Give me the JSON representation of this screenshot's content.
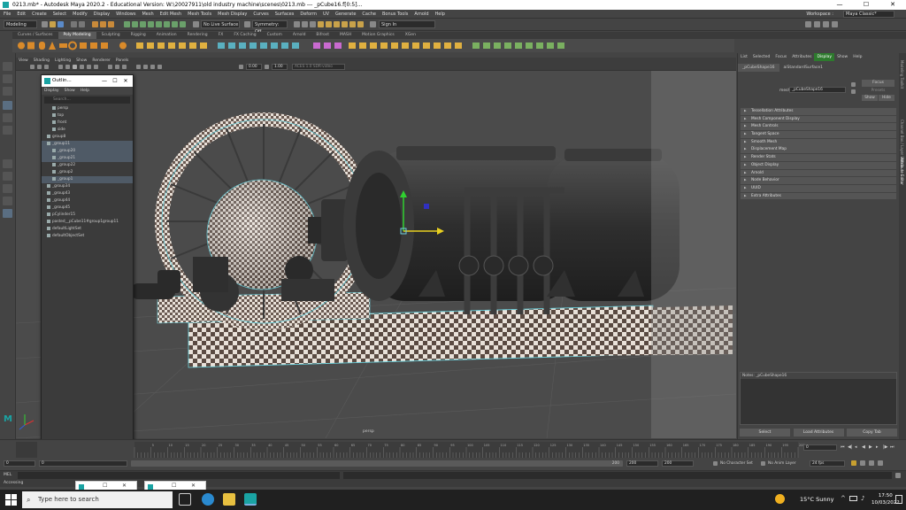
{
  "window": {
    "title": "0213.mb* - Autodesk Maya 2020.2 - Educational Version: W:\\20027911\\old industry machine\\scenes\\0213.mb  ---  _pCube16.f[0:5]...",
    "controls": [
      "—",
      "☐",
      "✕"
    ]
  },
  "menubar": {
    "items": [
      "File",
      "Edit",
      "Create",
      "Select",
      "Modify",
      "Display",
      "Windows",
      "Mesh",
      "Edit Mesh",
      "Mesh Tools",
      "Mesh Display",
      "Curves",
      "Surfaces",
      "Deform",
      "UV",
      "Generate",
      "Cache",
      "Bonus Tools",
      "Arnold",
      "Help"
    ],
    "workspace_label": "Workspace :",
    "workspace_value": "Maya Classic*"
  },
  "statusline": {
    "mode": "Modeling",
    "live_surface": "No Live Surface",
    "symmetry": "Symmetry: Off",
    "sign_in": "Sign In"
  },
  "shelf_tabs": {
    "items": [
      "Curves / Surfaces",
      "Poly Modeling",
      "Sculpting",
      "Rigging",
      "Animation",
      "Rendering",
      "FX",
      "FX Caching",
      "Custom",
      "Arnold",
      "Bifrost",
      "MASH",
      "Motion Graphics",
      "XGen"
    ],
    "active": "Poly Modeling"
  },
  "viewport": {
    "menu": [
      "View",
      "Shading",
      "Lighting",
      "Show",
      "Renderer",
      "Panels"
    ],
    "field_a": "0.00",
    "field_b": "1.00",
    "color_space": "ACES 1.0 SDR-video",
    "camera_label": "persp"
  },
  "outliner": {
    "title": "Outlin...",
    "controls": [
      "—",
      "☐",
      "✕"
    ],
    "menu": [
      "Display",
      "Show",
      "Help"
    ],
    "search_placeholder": "Search...",
    "items": [
      {
        "label": "persp",
        "selected": false,
        "indent": 1
      },
      {
        "label": "top",
        "selected": false,
        "indent": 1
      },
      {
        "label": "front",
        "selected": false,
        "indent": 1
      },
      {
        "label": "side",
        "selected": false,
        "indent": 1
      },
      {
        "label": "group8",
        "selected": false,
        "indent": 0
      },
      {
        "label": "_group11",
        "selected": true,
        "indent": 0
      },
      {
        "label": "_group20",
        "selected": true,
        "indent": 1
      },
      {
        "label": "_group21",
        "selected": true,
        "indent": 1
      },
      {
        "label": "_group22",
        "selected": false,
        "indent": 1
      },
      {
        "label": "_group2",
        "selected": false,
        "indent": 1
      },
      {
        "label": "_group1",
        "selected": true,
        "indent": 1
      },
      {
        "label": "_group34",
        "selected": false,
        "indent": 0
      },
      {
        "label": "_group43",
        "selected": false,
        "indent": 0
      },
      {
        "label": "_group44",
        "selected": false,
        "indent": 0
      },
      {
        "label": "_group45",
        "selected": false,
        "indent": 0
      },
      {
        "label": "pCylinder15",
        "selected": false,
        "indent": 0
      },
      {
        "label": "pasted__pCube11#group1group11",
        "selected": false,
        "indent": 0
      },
      {
        "label": "defaultLightSet",
        "selected": false,
        "indent": 0
      },
      {
        "label": "defaultObjectSet",
        "selected": false,
        "indent": 0
      }
    ]
  },
  "attribute_editor": {
    "menu": [
      "List",
      "Selected",
      "Focus",
      "Attributes",
      "Display",
      "Show",
      "Help"
    ],
    "tabs": [
      "_pCubeShape16",
      "aiStandardSurface1"
    ],
    "mesh_label": "mesh:",
    "mesh_value": "_pCubeShape16",
    "buttons_side": [
      "Focus",
      "Presets",
      "Show",
      "Hide"
    ],
    "sections": [
      "Tessellation Attributes",
      "Mesh Component Display",
      "Mesh Controls",
      "Tangent Space",
      "Smooth Mesh",
      "Displacement Map",
      "Render Stats",
      "Object Display",
      "Arnold",
      "Node Behavior",
      "UUID",
      "Extra Attributes"
    ],
    "notes_label": "Notes: _pCubeShape16",
    "bottom_buttons": [
      "Select",
      "Load Attributes",
      "Copy Tab"
    ]
  },
  "side_tabs": [
    "Modeling Toolkit",
    "Channel Box / Layer Editor",
    "Attribute Editor"
  ],
  "timeline": {
    "ticks": [
      "5",
      "10",
      "15",
      "20",
      "25",
      "30",
      "35",
      "40",
      "45",
      "50",
      "55",
      "60",
      "65",
      "70",
      "75",
      "80",
      "85",
      "90",
      "95",
      "100",
      "105",
      "110",
      "115",
      "120",
      "125",
      "130",
      "135",
      "140",
      "145",
      "150",
      "155",
      "160",
      "165",
      "170",
      "175",
      "180",
      "185",
      "190",
      "195",
      "200"
    ],
    "current_frame": "0",
    "range_start": "0",
    "range_start2": "0",
    "range_end": "200",
    "range_end2": "200",
    "range_end3": "200",
    "character_set": "No Character Set",
    "anim_layer": "No Anim Layer",
    "fps": "24 fps"
  },
  "command_line": {
    "label": "MEL"
  },
  "help_line": {
    "text": "Accessing"
  },
  "taskbar": {
    "search_text": "Type here to search",
    "temperature": "15°C  Sunny",
    "time": "17:50",
    "date": "10/03/2022"
  },
  "colors": {
    "accent_teal": "#1aa3a3",
    "selection": "#4f5a66",
    "focus_green": "#2d7a2d"
  }
}
